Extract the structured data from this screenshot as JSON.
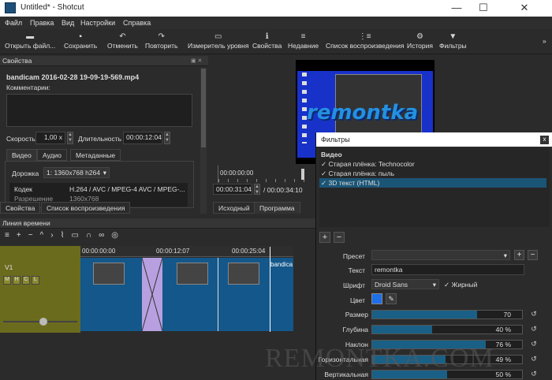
{
  "window": {
    "title": "Untitled* - Shotcut",
    "min": "—",
    "max": "☐",
    "close": "✕"
  },
  "menu": [
    "Файл",
    "Правка",
    "Вид",
    "Настройки",
    "Справка"
  ],
  "toolbar": [
    {
      "label": "Открыть файл...",
      "icon": "folder-icon"
    },
    {
      "label": "Сохранить",
      "icon": "save-icon"
    },
    {
      "label": "Отменить",
      "icon": "undo-icon"
    },
    {
      "label": "Повторить",
      "icon": "redo-icon"
    },
    {
      "label": "Измеритель уровня",
      "icon": "level-meter-icon"
    },
    {
      "label": "Свойства",
      "icon": "info-icon"
    },
    {
      "label": "Недавние",
      "icon": "recent-icon"
    },
    {
      "label": "Список воспроизведения",
      "icon": "playlist-icon"
    },
    {
      "label": "История",
      "icon": "history-icon"
    },
    {
      "label": "Фильтры",
      "icon": "filter-icon"
    }
  ],
  "toolbar_more": "»",
  "properties": {
    "title": "Свойства",
    "filename": "bandicam 2016-02-28 19-09-19-569.mp4",
    "comments_label": "Комментарии:",
    "speed_label": "Скорость",
    "speed_value": "1,00 x",
    "duration_label": "Длительность",
    "duration_value": "00:00:12:04",
    "tabs": [
      "Видео",
      "Аудио",
      "Метаданные"
    ],
    "track_label": "Дорожка",
    "track_value": "1: 1360x768 h264",
    "codec_label": "Кодек",
    "codec_value": "H.264 / AVC / MPEG-4 AVC / MPEG-...",
    "resolution_label": "Разрешение",
    "resolution_value": "1360x768"
  },
  "bottom_tabs": [
    "Свойства",
    "Список воспроизведения"
  ],
  "player": {
    "position": "00:00:31:04",
    "total": "/ 00:00:34:10",
    "ruler_start": "00:00:00:00",
    "tabs": [
      "Исходный",
      "Программа"
    ],
    "preview_text": "remontka"
  },
  "timeline": {
    "title": "Линия времени",
    "track_name": "V1",
    "track_buttons": [
      "M",
      "H",
      "C",
      "L"
    ],
    "times": [
      "00:00:00:00",
      "00:00:12:07",
      "00:00:25:04"
    ],
    "clip_label": "bandica"
  },
  "filters": {
    "title": "Фильтры",
    "close": "x",
    "category": "Видео",
    "items": [
      {
        "name": "Старая плёнка: Technocolor",
        "checked": true,
        "selected": false
      },
      {
        "name": "Старая плёнка: пыль",
        "checked": true,
        "selected": false
      },
      {
        "name": "3D текст (HTML)",
        "checked": true,
        "selected": true
      }
    ],
    "add": "+",
    "remove": "−",
    "preset_label": "Пресет",
    "text_label": "Текст",
    "text_value": "remontka",
    "font_label": "Шрифт",
    "font_value": "Droid Sans",
    "bold_label": "Жирный",
    "color_label": "Цвет",
    "color_value": "#1e6fe8",
    "sliders": [
      {
        "label": "Размер",
        "value": 70,
        "text": "70"
      },
      {
        "label": "Глубина",
        "value": 40,
        "text": "40 %"
      },
      {
        "label": "Наклон",
        "value": 76,
        "text": "76 %"
      },
      {
        "label": "Горизонтальная",
        "value": 49,
        "text": "49 %"
      },
      {
        "label": "Вертикальная",
        "value": 50,
        "text": "50 %"
      }
    ]
  },
  "watermark": "REMONTKA.COM",
  "colors": {
    "accent": "#1a5f85",
    "selection": "#1b5576",
    "preview_bg": "#1832c9"
  }
}
